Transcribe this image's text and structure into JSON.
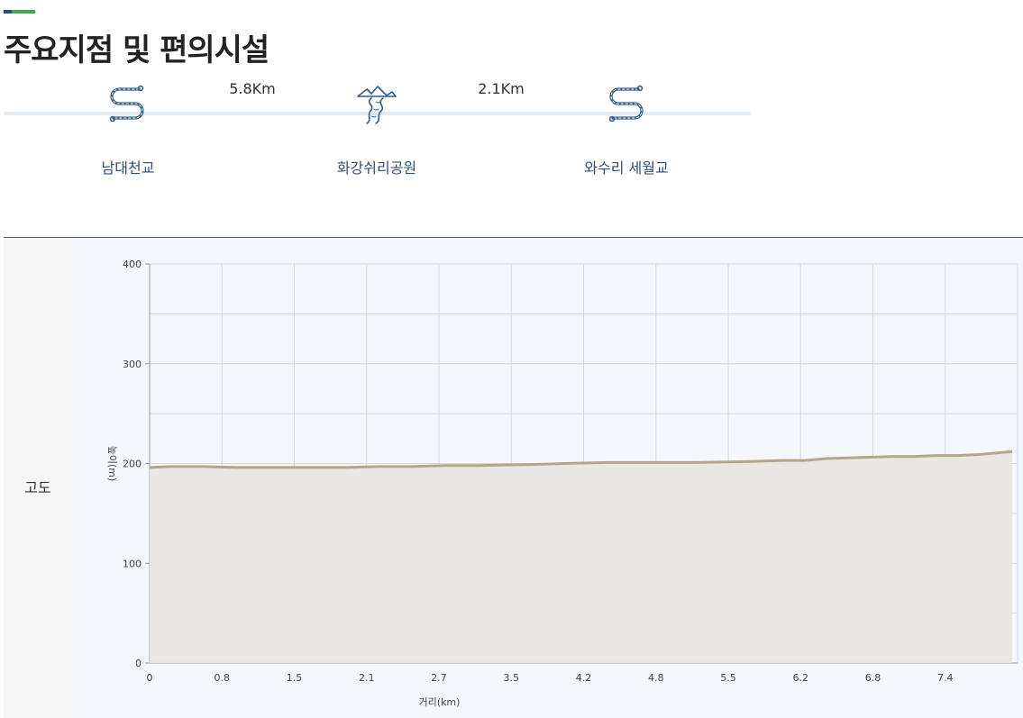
{
  "section": {
    "title": "주요지점 및 편의시설"
  },
  "colors": {
    "accent_blue": "#1f4e8c",
    "accent_green": "#3aaa4a",
    "route_line": "#e3eaf2",
    "icon_stroke": "#2e5d92",
    "stop_text": "#2b4f7c",
    "elevation_line": "#b5a68a",
    "elevation_fill": "#e8e6e1",
    "grid": "#d5d9de"
  },
  "stops": [
    {
      "name": "남대천교",
      "icon": "winding-road-icon"
    },
    {
      "name": "화강쉬리공원",
      "icon": "river-mountain-icon"
    },
    {
      "name": "와수리 세월교",
      "icon": "winding-road-icon"
    }
  ],
  "segments": [
    {
      "distance": "5.8Km"
    },
    {
      "distance": "2.1Km"
    }
  ],
  "elevation": {
    "row_label": "고도"
  },
  "chart_data": {
    "type": "area",
    "xlabel": "거리(km)",
    "ylabel": "높이(m)",
    "x_tick_labels": [
      "0",
      "0.8",
      "1.5",
      "2.1",
      "2.7",
      "3.5",
      "4.2",
      "4.8",
      "5.5",
      "6.2",
      "6.8",
      "7.4"
    ],
    "y_ticks": [
      0,
      100,
      200,
      300,
      400
    ],
    "ylim": [
      0,
      400
    ],
    "grid": true,
    "x": [
      0,
      0.2,
      0.5,
      0.8,
      1.0,
      1.2,
      1.5,
      1.8,
      2.1,
      2.4,
      2.7,
      3.0,
      3.5,
      3.8,
      4.2,
      4.5,
      4.8,
      5.0,
      5.5,
      5.8,
      6.0,
      6.2,
      6.5,
      6.8,
      7.0,
      7.2,
      7.4,
      7.6,
      7.8,
      7.9
    ],
    "y": [
      196,
      197,
      197,
      196,
      196,
      196,
      196,
      196,
      197,
      197,
      198,
      198,
      199,
      200,
      201,
      201,
      201,
      201,
      202,
      203,
      203,
      205,
      206,
      207,
      207,
      208,
      208,
      209,
      211,
      212
    ]
  }
}
